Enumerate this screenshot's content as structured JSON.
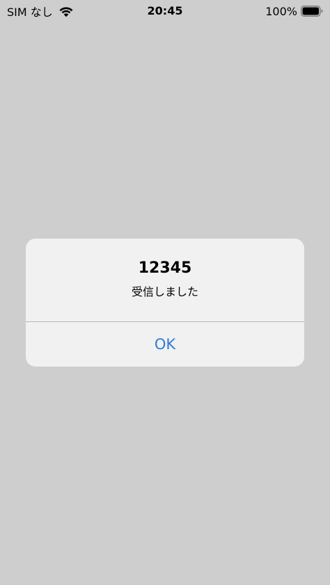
{
  "status_bar": {
    "carrier": "SIM なし",
    "time": "20:45",
    "battery_percent": "100%",
    "battery_level": 1.0
  },
  "alert": {
    "title": "12345",
    "message": "受信しました",
    "ok_label": "OK"
  },
  "colors": {
    "background": "#cecece",
    "alert_background": "#f1f1f1",
    "button_text": "#2f7bd8",
    "divider": "#b4b4b6"
  },
  "icons": [
    "wifi-icon",
    "battery-icon"
  ]
}
